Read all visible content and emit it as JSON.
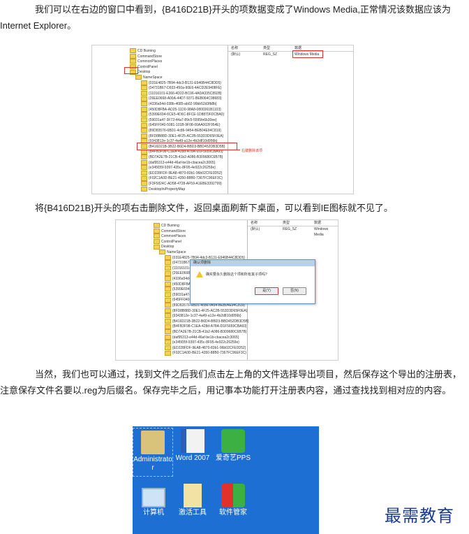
{
  "paragraphs": {
    "p1": "我们可以在右边的窗口中看到，{B416D21B}开头的项数据变成了Windows Media,正常情况该数据应该为Internet  Explorer。",
    "p2": "将{B416D21B}开头的项右击删除文件，返回桌面刷新下桌面，可以看到IE图标就不见了。",
    "p3": "当然，我们也可以通过，找到文件之后我们点击左上角的文件选择导出项目，然后保存这个导出的注册表，注意保存文件名要以.reg为后缀名。保存完毕之后，用记事本功能打开注册表内容，通过查找找到相对应的内容。"
  },
  "shot1": {
    "tree_items": [
      "CD Burning",
      "CommandStore",
      "CommonPlaces",
      "ControlPanel",
      "Desktop",
      "NameSpace",
      "{031E4825-7B94-4dc3-B131-E946B44C8DD5}",
      "{04731B67-D933-450a-90E6-4ACD2E9408FE}",
      "{11016101-E366-4D22-BC06-4ADA335C892B}",
      "{26EE0668-A00A-44D7-9371-BEB064C98683}",
      "{4336a54d-038b-4685-ab02-99bb52d3fb8b}",
      "{450D8FBA-AD25-11D0-98A8-0800361B1103}",
      "{5399E694-6CE5-4D6C-8FCE-1D8870FDCBA0}",
      "{59031a47-3F72-44a7-89c5-5595fe6b30ee}",
      "{645FF040-5081-101B-9F08-00AA002F954E}",
      "{89D83576-6BD1-4c86-9454-BEB04E94C819}",
      "{8FD8B88D-30E1-4F25-AC2B-553D3D65F0EA}",
      "{9343812e-1c37-4a49-a12e-4b2d810d956b}",
      "{B416D21B-3B22-B6D4-BBD3-BBD452DB3D5B}",
      "{B4FB3F98-C1EA-428d-A78A-D1F5659CBA93}",
      "{BD7A2E7B-21CB-41b2-A086-B309680C6B7B}",
      "{daf95313-e44d-46af-be1b-cbacea2c3065}",
      "{e345f35f-9397-435c-8F95-4e922c26259e}",
      "{ED228FDF-9EA8-4870-83b1-96b02CFE0D52}",
      "{F02C1A0D-BE21-4350-88B0-7367FC96EF3C}",
      "{F3F5824C-AD58-4728-AF59-A1EBE3392799}",
      "DesktopIniPropertyMap"
    ],
    "note": "右键删除该项",
    "headers": [
      "名称",
      "类型",
      "数据"
    ],
    "value_row": [
      "(默认)",
      "REG_SZ",
      "Windows Media"
    ]
  },
  "shot2": {
    "headers": [
      "名称",
      "类型",
      "数据"
    ],
    "value_row": [
      "(默认)",
      "REG_SZ",
      "Windows Media"
    ],
    "dialog_title": "确认项删除",
    "dialog_msg": "确实要永久删除这个项和所有其子项吗?",
    "yes": "是(Y)",
    "no": "否(N)"
  },
  "desktop": {
    "icons": [
      {
        "label": "Administrator",
        "icon": "user-folder-icon"
      },
      {
        "label": "Word 2007",
        "icon": "word-icon"
      },
      {
        "label": "爱奇艺PPS",
        "icon": "iqiyi-icon"
      },
      {
        "label": "计算机",
        "icon": "computer-icon"
      },
      {
        "label": "激活工具",
        "icon": "folder-shortcut-icon"
      },
      {
        "label": "软件管家",
        "icon": "software-manager-icon"
      }
    ]
  },
  "watermark": "最需教育",
  "colors": {
    "highlight": "#e0322b",
    "desktop": "#1e6fd4",
    "watermark": "#1a3b97"
  }
}
